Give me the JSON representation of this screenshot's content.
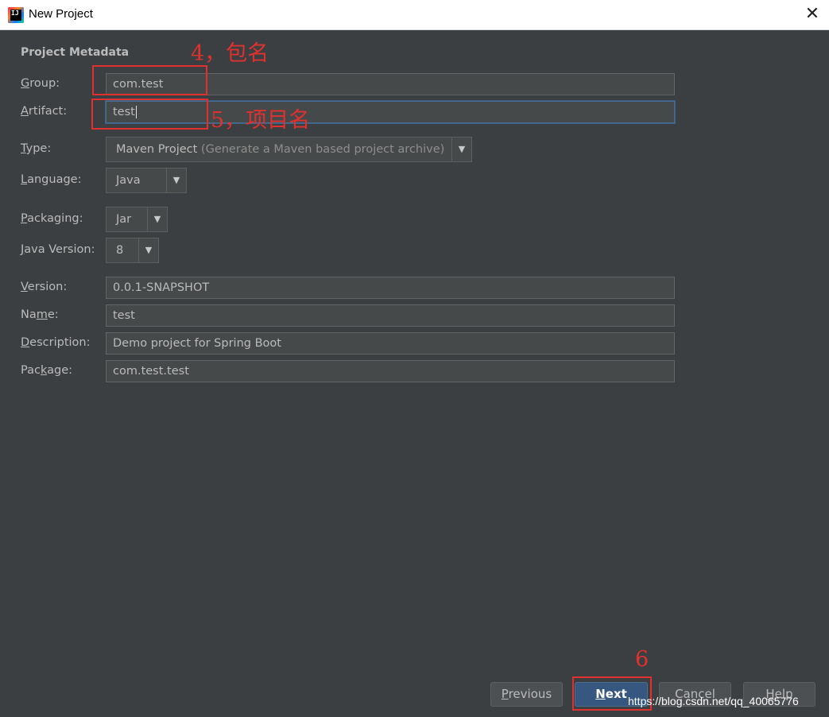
{
  "window": {
    "title": "New Project",
    "icon": "intellij-idea-icon",
    "icon_text": "IJ"
  },
  "section": {
    "title": "Project Metadata"
  },
  "form": {
    "group": {
      "label_pre": "",
      "label_key": "G",
      "label_post": "roup:",
      "value": "com.test"
    },
    "artifact": {
      "label_pre": "",
      "label_key": "A",
      "label_post": "rtifact:",
      "value": "test"
    },
    "type": {
      "label_pre": "",
      "label_key": "T",
      "label_post": "ype:",
      "value": "Maven Project",
      "hint": "(Generate a Maven based project archive)"
    },
    "language": {
      "label_pre": "",
      "label_key": "L",
      "label_post": "anguage:",
      "value": "Java"
    },
    "packaging": {
      "label_pre": "",
      "label_key": "P",
      "label_post": "ackaging:",
      "value": "Jar"
    },
    "java_version": {
      "label_pre": "",
      "label_key": "J",
      "label_post": "ava Version:",
      "value": "8"
    },
    "version": {
      "label_pre": "",
      "label_key": "V",
      "label_post": "ersion:",
      "value": "0.0.1-SNAPSHOT"
    },
    "name": {
      "label_pre": "Na",
      "label_key": "m",
      "label_post": "e:",
      "value": "test"
    },
    "description": {
      "label_pre": "",
      "label_key": "D",
      "label_post": "escription:",
      "value": "Demo project for Spring Boot"
    },
    "package": {
      "label_pre": "Pac",
      "label_key": "k",
      "label_post": "age:",
      "value": "com.test.test"
    }
  },
  "buttons": {
    "previous": {
      "key": "P",
      "rest": "revious"
    },
    "next": {
      "key": "N",
      "rest": "ext"
    },
    "cancel": "Cancel",
    "help": {
      "key": "H",
      "rest": "elp"
    }
  },
  "annotations": {
    "group_note": "4，包名",
    "artifact_note": "5，项目名",
    "next_note": "6",
    "color": "#e0312f"
  },
  "watermark": "https://blog.csdn.net/qq_40065776",
  "colors": {
    "background": "#3c3f41",
    "field": "#45494a",
    "text": "#bbbbbb",
    "default_button": "#365880"
  }
}
